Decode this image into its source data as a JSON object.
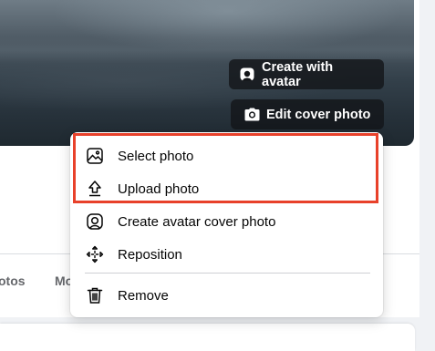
{
  "cover": {
    "create_avatar_label": "Create with avatar",
    "edit_cover_label": "Edit cover photo"
  },
  "tabs": [
    {
      "label": "otos"
    },
    {
      "label": "Mo"
    }
  ],
  "menu": {
    "items": [
      {
        "label": "Select photo",
        "icon": "image-icon"
      },
      {
        "label": "Upload photo",
        "icon": "upload-icon"
      },
      {
        "label": "Create avatar cover photo",
        "icon": "avatar-icon"
      },
      {
        "label": "Reposition",
        "icon": "move-icon"
      },
      {
        "label": "Remove",
        "icon": "trash-icon"
      }
    ]
  },
  "colors": {
    "highlight": "#e8412a",
    "button_bg": "#141619",
    "page_bg": "#f0f2f5"
  }
}
